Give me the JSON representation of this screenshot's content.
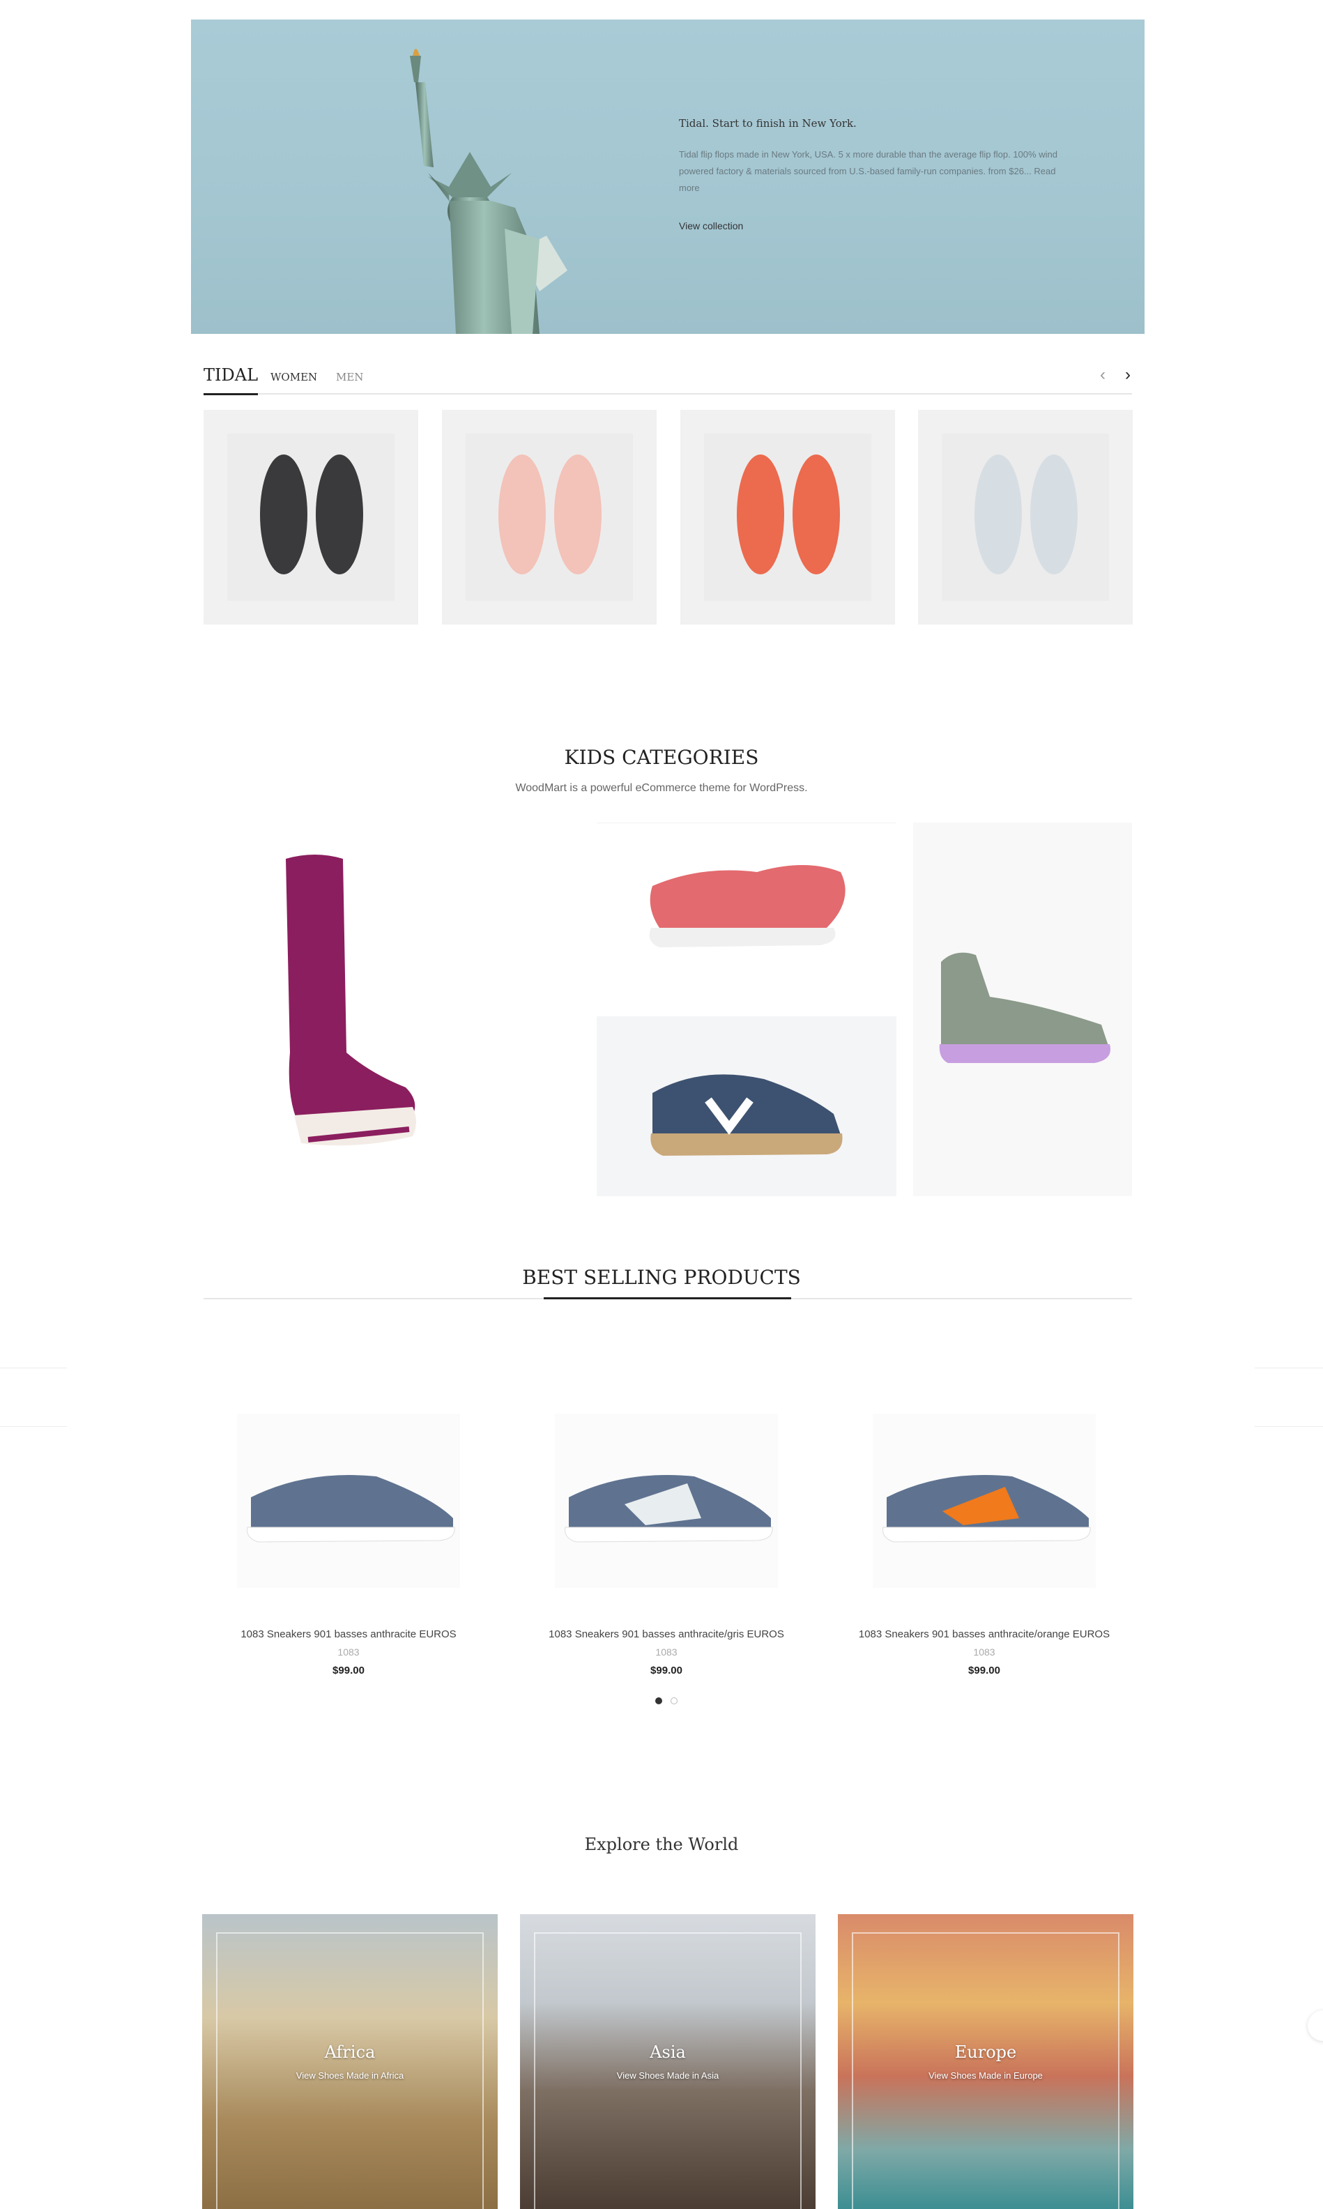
{
  "hero": {
    "title": "Tidal. Start to finish in New York.",
    "description": "Tidal flip flops made in New York, USA. 5 x more durable than the average flip flop. 100% wind powered factory & materials sourced from U.S.-based family-run companies. from $26... Read more",
    "link": "View collection"
  },
  "tabs": {
    "items": [
      "TIDAL",
      "WOMEN",
      "MEN"
    ],
    "prev_icon": "chevron-left-icon",
    "next_icon": "chevron-right-icon"
  },
  "products_row": {
    "colors": [
      "#3a3a3c",
      "#f3c2b8",
      "#ec6a4e",
      "#d6dee3"
    ]
  },
  "kids": {
    "title": "KIDS CATEGORIES",
    "subtitle": "WoodMart is a powerful eCommerce theme for WordPress."
  },
  "best_selling": {
    "title": "BEST SELLING PRODUCTS",
    "products": [
      {
        "name": "1083 Sneakers 901 basses anthracite EUROS",
        "sku": "1083",
        "price": "$99.00",
        "accent": "#5f7390"
      },
      {
        "name": "1083 Sneakers 901 basses anthracite/gris EUROS",
        "sku": "1083",
        "price": "$99.00",
        "accent": "#e8edf0"
      },
      {
        "name": "1083 Sneakers 901 basses anthracite/orange EUROS",
        "sku": "1083",
        "price": "$99.00",
        "accent": "#f07a1c"
      }
    ]
  },
  "explore": {
    "title": "Explore the World",
    "regions": [
      {
        "title": "Africa",
        "subtitle": "View Shoes Made in Africa"
      },
      {
        "title": "Asia",
        "subtitle": "View Shoes Made in Asia"
      },
      {
        "title": "Europe",
        "subtitle": "View Shoes Made in Europe"
      }
    ]
  }
}
